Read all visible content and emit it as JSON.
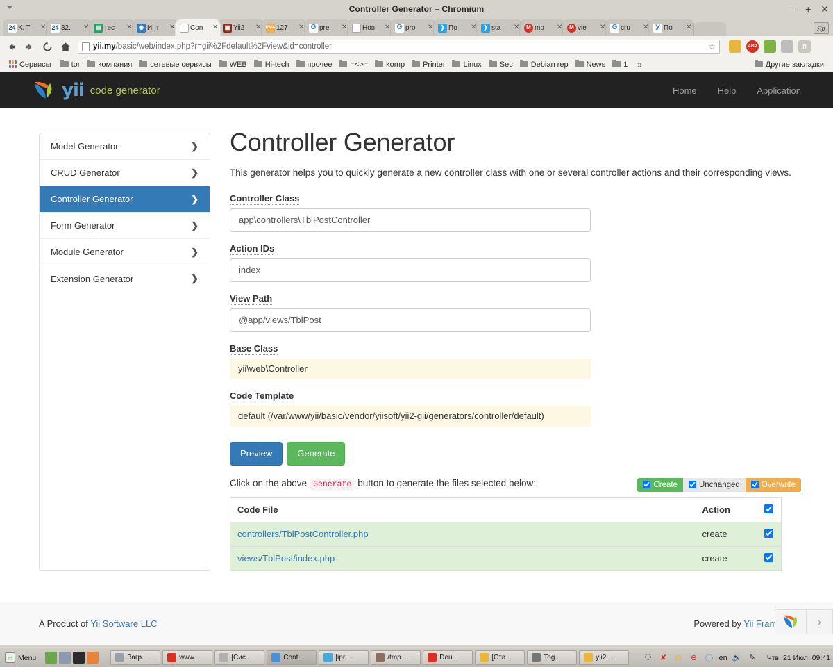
{
  "window": {
    "title": "Controller Generator – Chromium",
    "minimize": "–",
    "maximize": "+",
    "close": "✕"
  },
  "tabs": [
    {
      "label": "К. Т",
      "favicon": "24-blue"
    },
    {
      "label": "32.",
      "favicon": "24-blue"
    },
    {
      "label": "тес",
      "favicon": "sheets-green"
    },
    {
      "label": "Инт",
      "favicon": "globe-blue"
    },
    {
      "label": "Con",
      "favicon": "page-white",
      "active": true
    },
    {
      "label": "Yii2",
      "favicon": "image-red"
    },
    {
      "label": "127",
      "favicon": "pma-orange"
    },
    {
      "label": "pre",
      "favicon": "google-g"
    },
    {
      "label": "Нов",
      "favicon": "page-white"
    },
    {
      "label": "pro",
      "favicon": "google-g"
    },
    {
      "label": "По",
      "favicon": "blue-feather"
    },
    {
      "label": "sta",
      "favicon": "blue-feather"
    },
    {
      "label": "mo",
      "favicon": "m-red"
    },
    {
      "label": "vie",
      "favicon": "m-red"
    },
    {
      "label": "cru",
      "favicon": "google-g"
    },
    {
      "label": "По",
      "favicon": "yandex-y"
    }
  ],
  "tab_extra_label": "Яp",
  "omnibox": {
    "host": "yii.my",
    "path": "/basic/web/index.php?r=gii%2Fdefault%2Fview&id=controller",
    "star": "☆"
  },
  "extensions": [
    {
      "name": "folder-extension",
      "label": "",
      "color": "#e8b63a"
    },
    {
      "name": "adblock-extension",
      "label": "ABP",
      "color": "#d93025"
    },
    {
      "name": "lastpass-extension",
      "label": "",
      "color": "#7cb342"
    },
    {
      "name": "settings-extension",
      "label": "",
      "color": "#bdbdbd"
    },
    {
      "name": "r-extension",
      "label": "R",
      "color": "#c9c5bf"
    }
  ],
  "bookmarks": {
    "apps_label": "Сервисы",
    "items": [
      "tor",
      "компания",
      "сетевые сервисы",
      "WEB",
      "Hi-tech",
      "прочее",
      "=<>=",
      "komp",
      "Printer",
      "Linux",
      "Sec",
      "Debian rep",
      "News",
      "1"
    ],
    "overflow": "»",
    "other": "Другие закладки"
  },
  "site": {
    "brand_main": "yii",
    "brand_sub": "code generator",
    "nav": [
      "Home",
      "Help",
      "Application"
    ]
  },
  "sidebar": {
    "items": [
      {
        "label": "Model Generator",
        "active": false
      },
      {
        "label": "CRUD Generator",
        "active": false
      },
      {
        "label": "Controller Generator",
        "active": true
      },
      {
        "label": "Form Generator",
        "active": false
      },
      {
        "label": "Module Generator",
        "active": false
      },
      {
        "label": "Extension Generator",
        "active": false
      }
    ],
    "chevron": "❯"
  },
  "main": {
    "title": "Controller Generator",
    "description": "This generator helps you to quickly generate a new controller class with one or several controller actions and their corresponding views.",
    "fields": [
      {
        "label": "Controller Class",
        "value": "app\\controllers\\TblPostController",
        "type": "input"
      },
      {
        "label": "Action IDs",
        "value": "index",
        "type": "input"
      },
      {
        "label": "View Path",
        "value": "@app/views/TblPost",
        "type": "input"
      },
      {
        "label": "Base Class",
        "value": "yii\\web\\Controller",
        "type": "static"
      },
      {
        "label": "Code Template",
        "value": "default (/var/www/yii/basic/vendor/yiisoft/yii2-gii/generators/controller/default)",
        "type": "static"
      }
    ],
    "buttons": {
      "preview": "Preview",
      "generate": "Generate"
    },
    "hint_before": "Click on the above",
    "hint_code": "Generate",
    "hint_after": "button to generate the files selected below:",
    "toggles": [
      {
        "label": "Create",
        "checked": true,
        "style": "create"
      },
      {
        "label": "Unchanged",
        "checked": true,
        "style": "unchanged"
      },
      {
        "label": "Overwrite",
        "checked": true,
        "style": "overwrite"
      }
    ],
    "table": {
      "headers": [
        "Code File",
        "Action",
        ""
      ],
      "header_checked": true,
      "rows": [
        {
          "file": "controllers/TblPostController.php",
          "action": "create",
          "checked": true
        },
        {
          "file": "views/TblPost/index.php",
          "action": "create",
          "checked": true
        }
      ]
    }
  },
  "footer": {
    "left_prefix": "A Product of",
    "left_link": "Yii Software LLC",
    "right_prefix": "Powered by",
    "right_link": "Yii Framework",
    "debug_toggle": "›"
  },
  "taskbar": {
    "menu_label": "Menu",
    "menu_icon": "mint-logo",
    "quicklaunch": [
      {
        "name": "show-desktop-icon",
        "color": "#6aa84f"
      },
      {
        "name": "file-manager-icon",
        "color": "#8d99ae"
      },
      {
        "name": "terminal-icon",
        "color": "#2b2b2b"
      },
      {
        "name": "firefox-icon",
        "color": "#e8833a"
      }
    ],
    "windows": [
      {
        "label": "Загр...",
        "icon_color": "#9aa0a6",
        "active": false
      },
      {
        "label": "www...",
        "icon_color": "#d93025",
        "active": false
      },
      {
        "label": "[Сис...",
        "icon_color": "#b0b0b0",
        "active": false
      },
      {
        "label": "Cont...",
        "icon_color": "#4a90d9",
        "active": true
      },
      {
        "label": "[ipr ...",
        "icon_color": "#4aa8d9",
        "active": false
      },
      {
        "label": "/tmp...",
        "icon_color": "#8d6e63",
        "active": false
      },
      {
        "label": "Dou...",
        "icon_color": "#d93025",
        "active": false
      },
      {
        "label": "[Ста...",
        "icon_color": "#e8b63a",
        "active": false
      },
      {
        "label": "Tog...",
        "icon_color": "#757575",
        "active": false
      },
      {
        "label": "yii2 ...",
        "icon_color": "#e8b63a",
        "active": false
      }
    ],
    "tray": [
      {
        "name": "power-icon",
        "glyph": "⏻",
        "color": "#333"
      },
      {
        "name": "close-red-icon",
        "glyph": "✘",
        "color": "#d93025"
      },
      {
        "name": "note-icon",
        "glyph": "▤",
        "color": "#e8b63a"
      },
      {
        "name": "block-icon",
        "glyph": "⊖",
        "color": "#d93025"
      },
      {
        "name": "info-icon",
        "glyph": "ⓘ",
        "color": "#2b7fd4"
      }
    ],
    "layout": "en",
    "volume_icon": "🔊",
    "pen_icon": "✎",
    "clock": "Чтв, 21 Июл, 09:41"
  }
}
